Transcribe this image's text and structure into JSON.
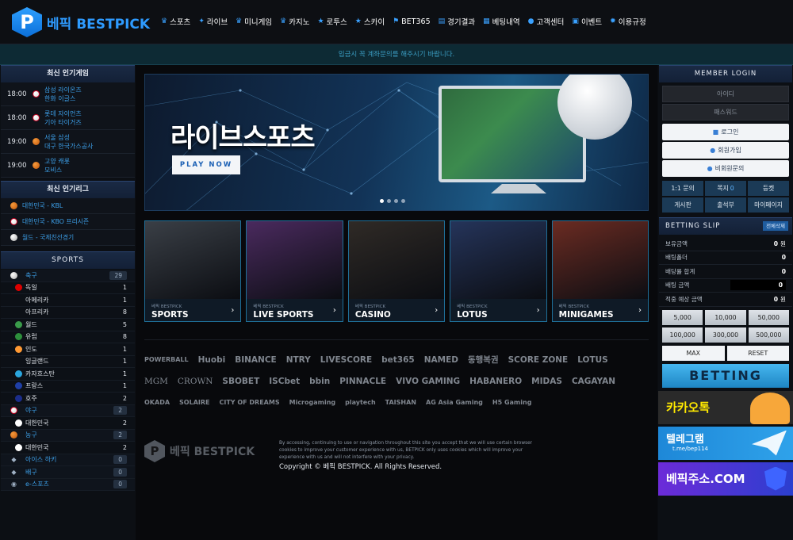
{
  "brand": {
    "logo_letter": "P",
    "name": "베픽 BESTPICK",
    "accent": "#2e9bff"
  },
  "nav": [
    {
      "label": "스포츠",
      "icon": "trophy-icon"
    },
    {
      "label": "라이브",
      "icon": "runner-icon"
    },
    {
      "label": "미니게임",
      "icon": "crown-icon"
    },
    {
      "label": "카지노",
      "icon": "crown-icon"
    },
    {
      "label": "로투스",
      "icon": "star-icon"
    },
    {
      "label": "스카이",
      "icon": "star-icon"
    },
    {
      "label": "BET365",
      "icon": "flag-icon"
    },
    {
      "label": "경기결과",
      "icon": "doc-icon"
    },
    {
      "label": "베팅내역",
      "icon": "list-icon"
    },
    {
      "label": "고객센터",
      "icon": "info-icon"
    },
    {
      "label": "이벤트",
      "icon": "gift-icon"
    },
    {
      "label": "이용규정",
      "icon": "gear-icon"
    }
  ],
  "notice": "입금시 꼭 계좌문의를 해주시기 바랍니다.",
  "left": {
    "popular_games_title": "최신 인기게임",
    "popular_games": [
      {
        "time": "18:00",
        "ball": "baseball",
        "home": "삼성 라이온즈",
        "away": "한화 이글스"
      },
      {
        "time": "18:00",
        "ball": "baseball",
        "home": "롯데 자이언츠",
        "away": "기아 타이거즈"
      },
      {
        "time": "19:00",
        "ball": "basketball",
        "home": "서울 삼성",
        "away": "대구 한국가스공사"
      },
      {
        "time": "19:00",
        "ball": "basketball",
        "home": "고양 캐롯",
        "away": "모비스"
      }
    ],
    "popular_leagues_title": "최신 인기리그",
    "popular_leagues": [
      {
        "ball": "basketball",
        "label": "대한민국 - KBL"
      },
      {
        "ball": "baseball",
        "label": "대한민국 - KBO 프리시즌"
      },
      {
        "ball": "soccer",
        "label": "월드 - 국제친선경기"
      }
    ],
    "sports_title": "SPORTS",
    "sports": [
      {
        "kind": "main",
        "name": "축구",
        "count": "29",
        "icon": "soccer",
        "badge": true
      },
      {
        "kind": "sub",
        "name": "독일",
        "count": "1",
        "flag": "#dd0000"
      },
      {
        "kind": "sub",
        "name": "아메리카",
        "count": "1",
        "flag": ""
      },
      {
        "kind": "sub",
        "name": "아프리카",
        "count": "8",
        "flag": ""
      },
      {
        "kind": "sub",
        "name": "월드",
        "count": "5",
        "flag": "#3a9b4a"
      },
      {
        "kind": "sub",
        "name": "유럽",
        "count": "8",
        "flag": "#2d8f3c"
      },
      {
        "kind": "sub",
        "name": "인도",
        "count": "1",
        "flag": "#ff9933"
      },
      {
        "kind": "sub",
        "name": "잉글랜드",
        "count": "1",
        "flag": ""
      },
      {
        "kind": "sub",
        "name": "카자흐스탄",
        "count": "1",
        "flag": "#2ba6de"
      },
      {
        "kind": "sub",
        "name": "프랑스",
        "count": "1",
        "flag": "#1f3fa6"
      },
      {
        "kind": "sub",
        "name": "호주",
        "count": "2",
        "flag": "#1b2d8a"
      },
      {
        "kind": "main",
        "name": "야구",
        "count": "2",
        "icon": "baseball",
        "badge": true
      },
      {
        "kind": "sub",
        "name": "대한민국",
        "count": "2",
        "flag": "#ffffff"
      },
      {
        "kind": "main",
        "name": "농구",
        "count": "2",
        "icon": "basketball",
        "badge": true
      },
      {
        "kind": "sub",
        "name": "대한민국",
        "count": "2",
        "flag": "#ffffff"
      },
      {
        "kind": "main",
        "name": "아이스 하키",
        "count": "0",
        "icon": "hockey",
        "badge": true
      },
      {
        "kind": "main",
        "name": "배구",
        "count": "0",
        "icon": "volleyball",
        "badge": true
      },
      {
        "kind": "main",
        "name": "e-스포츠",
        "count": "0",
        "icon": "gamepad",
        "badge": true
      }
    ]
  },
  "banner": {
    "title": "라이브스포츠",
    "button": "PLAY NOW",
    "slides": 4,
    "active_slide": 1
  },
  "tiles": [
    {
      "small": "베픽 BESTPICK",
      "label": "SPORTS",
      "color": "#3a3f46"
    },
    {
      "small": "베픽 BESTPICK",
      "label": "LIVE SPORTS",
      "color": "#4a2a5e"
    },
    {
      "small": "베픽 BESTPICK",
      "label": "CASINO",
      "color": "#2f2a26"
    },
    {
      "small": "베픽 BESTPICK",
      "label": "LOTUS",
      "color": "#25345a"
    },
    {
      "small": "베픽 BESTPICK",
      "label": "MINIGAMES",
      "color": "#6a2b22"
    }
  ],
  "partners": [
    [
      "POWERBALL",
      "Huobi",
      "BINANCE",
      "NTRY",
      "LIVESCORE",
      "bet365",
      "NAMED",
      "동행복권",
      "SCORE ZONE",
      "LOTUS"
    ],
    [
      "MGM",
      "CROWN",
      "SBOBET",
      "ISCbet",
      "bbin",
      "PINNACLE",
      "VIVO GAMING",
      "HABANERO",
      "MIDAS",
      "CAGAYAN"
    ],
    [
      "OKADA",
      "SOLAIRE",
      "CITY OF DREAMS",
      "Microgaming",
      "playtech",
      "TAISHAN",
      "AG Asia Gaming",
      "H5 Gaming"
    ]
  ],
  "footer": {
    "brand": "베픽 BESTPICK",
    "disclaimer": "By accessing, continuing to use or navigation throughout this site you accept that we will use certain browser cookies to improve your customer experience with us, BETPICK only uses cookies which will improve your experience with us and will not interfere with your privacy.",
    "copyright": "Copyright © 베픽 BESTPICK. All Rights Reserved."
  },
  "login": {
    "title": "MEMBER LOGIN",
    "id_placeholder": "아이디",
    "pw_placeholder": "패스워드",
    "login_btn": "로그인",
    "signup_btn": "회원가입",
    "guest_btn": "비회원문의",
    "links": [
      {
        "label": "1:1 문의",
        "num": ""
      },
      {
        "label": "쪽지",
        "num": "0"
      },
      {
        "label": "등켓",
        "num": ""
      },
      {
        "label": "게시판",
        "num": ""
      },
      {
        "label": "출석부",
        "num": ""
      },
      {
        "label": "마이페이지",
        "num": ""
      }
    ]
  },
  "slip": {
    "title": "BETTING SLIP",
    "tag": "전체삭제",
    "rows": [
      {
        "label": "보유금액",
        "value": "0",
        "unit": "원"
      },
      {
        "label": "배팅폴더",
        "value": "0",
        "unit": ""
      },
      {
        "label": "배당률 합계",
        "value": "0",
        "unit": ""
      },
      {
        "label": "배팅 금액",
        "value": "0",
        "unit": "",
        "input": true
      },
      {
        "label": "적중 예상 금액",
        "value": "0",
        "unit": "원"
      }
    ],
    "amounts": [
      "5,000",
      "10,000",
      "50,000",
      "100,000",
      "300,000",
      "500,000"
    ],
    "max": "MAX",
    "reset": "RESET",
    "betting": "BETTING"
  },
  "promos": [
    {
      "kind": "kakao",
      "title": "카카오톡",
      "sub": ""
    },
    {
      "kind": "tele",
      "title": "텔레그램",
      "sub": "t.me/bep114"
    },
    {
      "kind": "addr",
      "title": "베픽주소.COM",
      "sub": ""
    }
  ]
}
